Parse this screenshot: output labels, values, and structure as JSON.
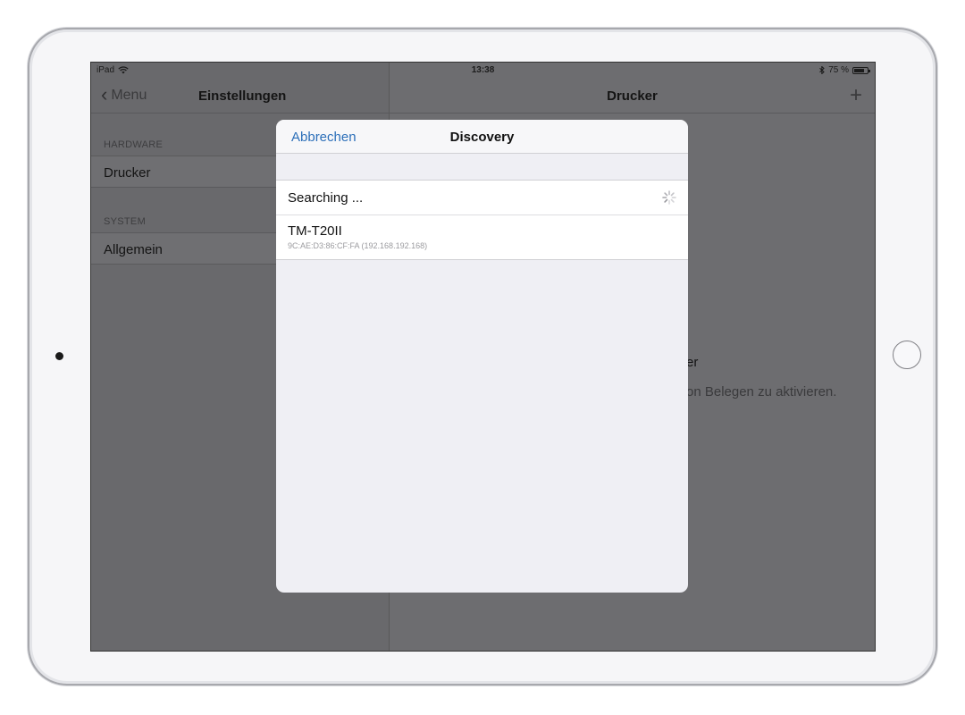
{
  "status_bar": {
    "device": "iPad",
    "time": "13:38",
    "battery": "75 %",
    "battery_level": 0.75
  },
  "master": {
    "back_label": "Menu",
    "title": "Einstellungen",
    "sections": [
      {
        "header": "HARDWARE",
        "item": "Drucker"
      },
      {
        "header": "SYSTEM",
        "item": "Allgemein"
      }
    ]
  },
  "detail": {
    "title": "Drucker",
    "add_symbol": "+",
    "empty_title_fragment": "er",
    "empty_desc_fragment": "on Belegen zu aktivieren."
  },
  "modal": {
    "cancel_label": "Abbrechen",
    "title": "Discovery",
    "searching_label": "Searching ...",
    "devices": [
      {
        "name": "TM-T20II",
        "address": "9C:AE:D3:86:CF:FA (192.168.192.168)"
      }
    ]
  },
  "colors": {
    "accent": "#2c6fb9",
    "dimmed_background": "#6d6d70",
    "modal_background": "#efeff4"
  },
  "icons": {
    "wifi": "wifi-icon",
    "bluetooth": "bluetooth-icon",
    "battery": "battery-icon",
    "back": "chevron-left-icon",
    "add": "plus-icon",
    "spinner": "activity-spinner-icon"
  }
}
